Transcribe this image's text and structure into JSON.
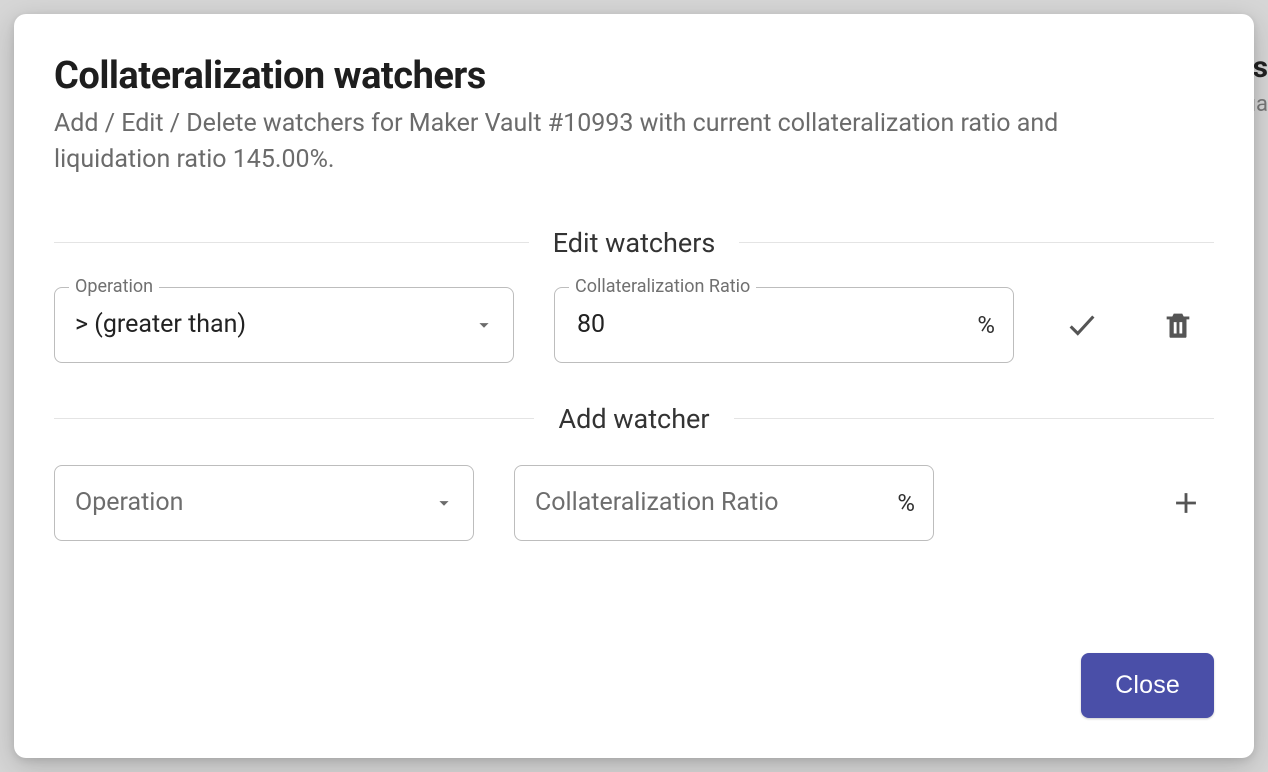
{
  "dialog": {
    "title": "Collateralization watchers",
    "subtitle": "Add / Edit / Delete watchers for Maker Vault #10993 with current collateralization ratio and liquidation ratio 145.00%."
  },
  "sections": {
    "edit": {
      "label": "Edit watchers",
      "operation": {
        "legend": "Operation",
        "value": "> (greater than)"
      },
      "ratio": {
        "legend": "Collateralization Ratio",
        "value": "80",
        "suffix": "%"
      }
    },
    "add": {
      "label": "Add watcher",
      "operation": {
        "placeholder": "Operation"
      },
      "ratio": {
        "placeholder": "Collateralization Ratio",
        "suffix": "%"
      }
    }
  },
  "footer": {
    "close": "Close"
  }
}
